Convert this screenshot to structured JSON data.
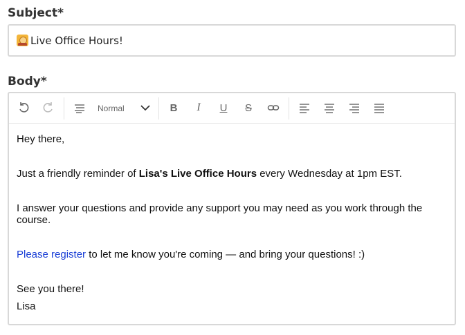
{
  "subject": {
    "label": "Subject*",
    "value": "Live Office Hours!",
    "emoji": "teacher-emoji-icon"
  },
  "body": {
    "label": "Body*",
    "toolbar": {
      "undo": "undo-icon",
      "redo": "redo-icon",
      "format_icon": "paragraph-format-icon",
      "format_value": "Normal",
      "bold": "B",
      "italic": "I",
      "underline": "U",
      "strike": "S",
      "link": "link-icon",
      "align": [
        "align-left-icon",
        "align-center-icon",
        "align-right-icon",
        "align-justify-icon"
      ]
    },
    "content": {
      "greeting": "Hey there,",
      "line2_pre": "Just a friendly reminder of ",
      "line2_bold": "Lisa's Live Office Hours",
      "line2_post": " every Wednesday at 1pm EST.",
      "line3a": "I answer your questions and provide any support you may need as you work through the",
      "line3b": "course.",
      "line4_link": "Please register",
      "line4_post": " to let me know you're coming — and bring your questions! :)",
      "signoff": "See you there!",
      "name": "Lisa"
    }
  },
  "colors": {
    "link": "#1a3fd6",
    "border": "#d8d8d8",
    "label": "#333333"
  }
}
